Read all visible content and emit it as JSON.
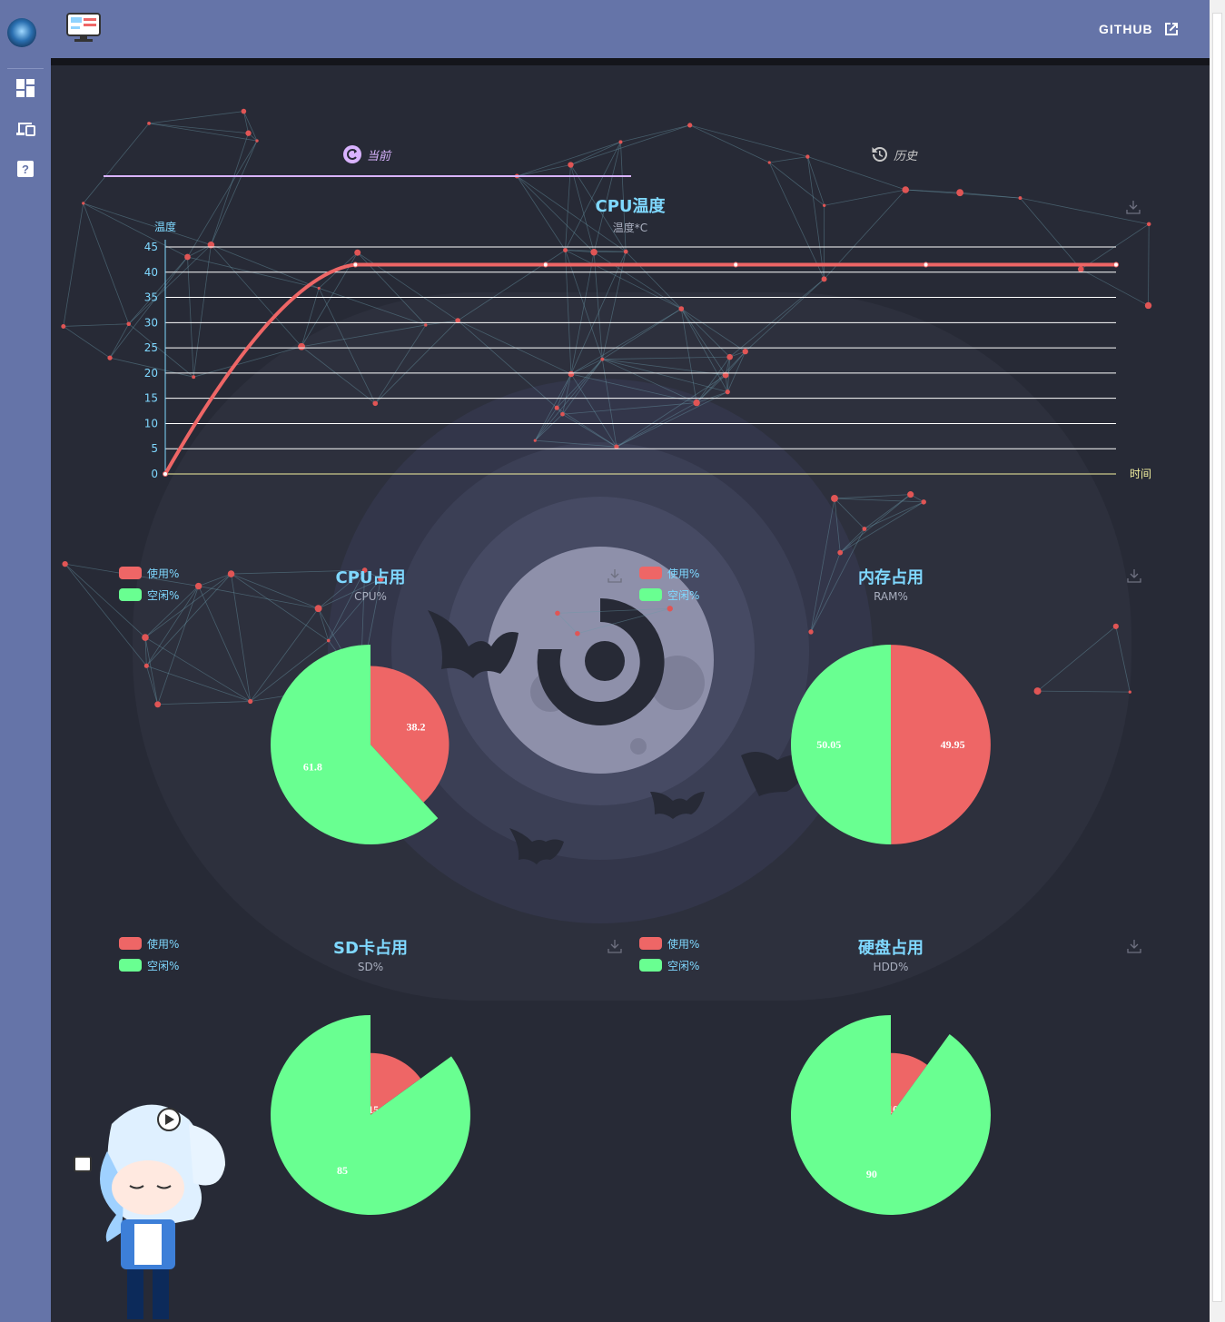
{
  "header": {
    "github_label": "GITHUB"
  },
  "sidebar": {
    "items": [
      {
        "icon": "dashboard-icon"
      },
      {
        "icon": "devices-icon"
      },
      {
        "icon": "help-icon"
      }
    ]
  },
  "tabs": [
    {
      "label": "当前",
      "icon": "refresh-circle-icon",
      "active": true
    },
    {
      "label": "历史",
      "icon": "history-icon",
      "active": false
    }
  ],
  "colors": {
    "used": "#ee6666",
    "free": "#69ff91",
    "accent": "#7fd8ff",
    "tab_active": "#d9b3ff"
  },
  "charts": {
    "temp": {
      "title": "CPU温度",
      "subtitle": "温度*C",
      "ylabel": "温度",
      "xlabel": "时间"
    },
    "cpu": {
      "title": "CPU占用",
      "subtitle": "CPU%"
    },
    "ram": {
      "title": "内存占用",
      "subtitle": "RAM%"
    },
    "sd": {
      "title": "SD卡占用",
      "subtitle": "SD%"
    },
    "hdd": {
      "title": "硬盘占用",
      "subtitle": "HDD%"
    }
  },
  "legend": {
    "used": "使用%",
    "free": "空闲%"
  },
  "chart_data": [
    {
      "type": "line",
      "title": "CPU温度",
      "subtitle": "温度*C",
      "ylabel": "温度",
      "xlabel": "时间",
      "y_ticks": [
        "0",
        "5",
        "10",
        "15",
        "20",
        "25",
        "30",
        "35",
        "40",
        "45"
      ],
      "ylim": [
        0,
        45
      ],
      "grid": true,
      "series": [
        {
          "values": [
            0,
            41.5,
            41.5,
            41.5,
            41.5,
            41.5
          ]
        }
      ]
    },
    {
      "type": "pie",
      "title": "CPU占用",
      "subtitle": "CPU%",
      "legend": [
        "使用%",
        "空闲%"
      ],
      "values": [
        38.2,
        61.8
      ]
    },
    {
      "type": "pie",
      "title": "内存占用",
      "subtitle": "RAM%",
      "legend": [
        "使用%",
        "空闲%"
      ],
      "values": [
        49.95,
        50.05
      ]
    },
    {
      "type": "pie",
      "title": "SD卡占用",
      "subtitle": "SD%",
      "legend": [
        "使用%",
        "空闲%"
      ],
      "values": [
        15,
        85
      ]
    },
    {
      "type": "pie",
      "title": "硬盘占用",
      "subtitle": "HDD%",
      "legend": [
        "使用%",
        "空闲%"
      ],
      "values": [
        10,
        90
      ]
    }
  ]
}
